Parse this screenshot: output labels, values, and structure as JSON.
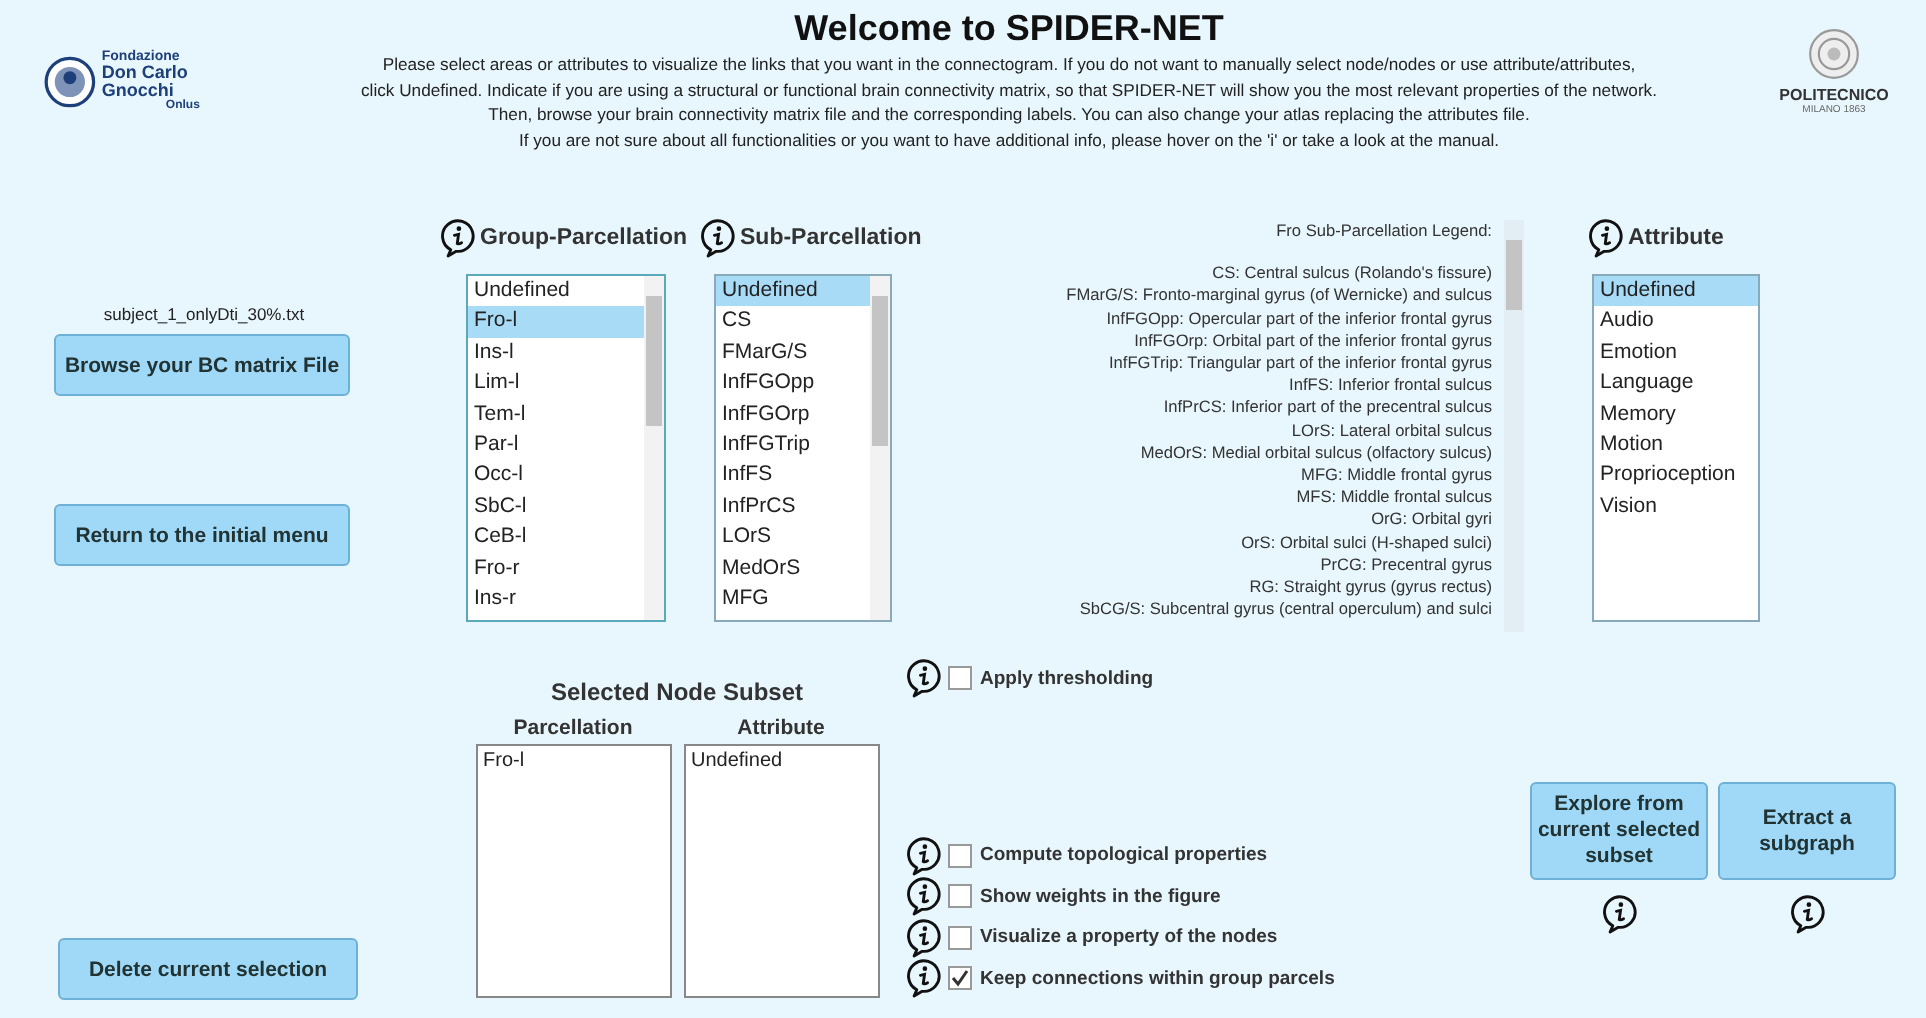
{
  "header": {
    "logo_left": {
      "lines": [
        "Fondazione",
        "Don Carlo Gnocchi",
        "Onlus"
      ]
    },
    "title": "Welcome to SPIDER-NET",
    "description": [
      "Please select areas or attributes to visualize the links that you want in the connectogram. If you do not want to manually select node/nodes or use attribute/attributes,",
      "click Undefined. Indicate if you are using a structural or functional brain connectivity matrix, so that SPIDER-NET will show you the most relevant properties of the network.",
      "Then, browse your brain connectivity matrix file and the corresponding labels. You can also change your atlas replacing the attributes file.",
      "If you are not sure about all functionalities or you want to have additional info, please hover on the 'i' or take a look at the manual."
    ],
    "logo_right": {
      "name": "POLITECNICO",
      "subtitle": "MILANO 1863"
    }
  },
  "file_name": "subject_1_onlyDti_30%.txt",
  "left_buttons": [
    "Browse your BC matrix File",
    "Return to the initial menu"
  ],
  "group_parcellation": {
    "label": "Group-Parcellation",
    "items": [
      {
        "text": "Undefined",
        "selected": false
      },
      {
        "text": "Fro-l",
        "selected": true
      },
      {
        "text": "Ins-l",
        "selected": false
      },
      {
        "text": "Lim-l",
        "selected": false
      },
      {
        "text": "Tem-l",
        "selected": false
      },
      {
        "text": "Par-l",
        "selected": false
      },
      {
        "text": "Occ-l",
        "selected": false
      },
      {
        "text": "SbC-l",
        "selected": false
      },
      {
        "text": "CeB-l",
        "selected": false
      },
      {
        "text": "Fro-r",
        "selected": false
      },
      {
        "text": "Ins-r",
        "selected": false
      }
    ]
  },
  "sub_parcellation": {
    "label": "Sub-Parcellation",
    "items": [
      {
        "text": "Undefined",
        "selected": true
      },
      {
        "text": "CS",
        "selected": false
      },
      {
        "text": "FMarG/S",
        "selected": false
      },
      {
        "text": "InfFGOpp",
        "selected": false
      },
      {
        "text": "InfFGOrp",
        "selected": false
      },
      {
        "text": "InfFGTrip",
        "selected": false
      },
      {
        "text": "InfFS",
        "selected": false
      },
      {
        "text": "InfPrCS",
        "selected": false
      },
      {
        "text": "LOrS",
        "selected": false
      },
      {
        "text": "MedOrS",
        "selected": false
      },
      {
        "text": "MFG",
        "selected": false
      }
    ]
  },
  "legend": {
    "title": "Fro Sub-Parcellation Legend:",
    "lines": [
      "CS: Central sulcus (Rolando's fissure)",
      "FMarG/S: Fronto-marginal gyrus (of Wernicke) and sulcus",
      "InfFGOpp: Opercular part of the inferior frontal gyrus",
      "InfFGOrp: Orbital part of the inferior frontal gyrus",
      "InfFGTrip: Triangular part of the inferior frontal gyrus",
      "InfFS: Inferior frontal sulcus",
      "InfPrCS: Inferior part of the precentral sulcus",
      "LOrS: Lateral orbital sulcus",
      "MedOrS: Medial orbital sulcus (olfactory sulcus)",
      "MFG: Middle frontal gyrus",
      "MFS: Middle frontal sulcus",
      "OrG: Orbital gyri",
      "OrS: Orbital sulci (H-shaped sulci)",
      "PrCG: Precentral gyrus",
      "RG: Straight gyrus (gyrus rectus)",
      "SbCG/S: Subcentral gyrus (central operculum) and sulci"
    ]
  },
  "attribute": {
    "label": "Attribute",
    "items": [
      {
        "text": "Undefined",
        "selected": true
      },
      {
        "text": "Audio",
        "selected": false
      },
      {
        "text": "Emotion",
        "selected": false
      },
      {
        "text": "Language",
        "selected": false
      },
      {
        "text": "Memory",
        "selected": false
      },
      {
        "text": "Motion",
        "selected": false
      },
      {
        "text": "Proprioception",
        "selected": false
      },
      {
        "text": "Vision",
        "selected": false
      }
    ]
  },
  "delete_button": "Delete current selection",
  "subset": {
    "title": "Selected Node Subset",
    "columns": [
      {
        "heading": "Parcellation",
        "items": [
          "Fro-l"
        ]
      },
      {
        "heading": "Attribute",
        "items": [
          "Undefined"
        ]
      }
    ]
  },
  "options": [
    {
      "label": "Apply thresholding",
      "checked": false
    },
    {
      "label": "Compute topological properties",
      "checked": false
    },
    {
      "label": "Show weights in the figure",
      "checked": false
    },
    {
      "label": "Visualize a property of the nodes",
      "checked": false
    },
    {
      "label": "Keep connections within group parcels",
      "checked": true
    }
  ],
  "action_buttons": [
    "Explore from current selected subset",
    "Extract a subgraph"
  ]
}
